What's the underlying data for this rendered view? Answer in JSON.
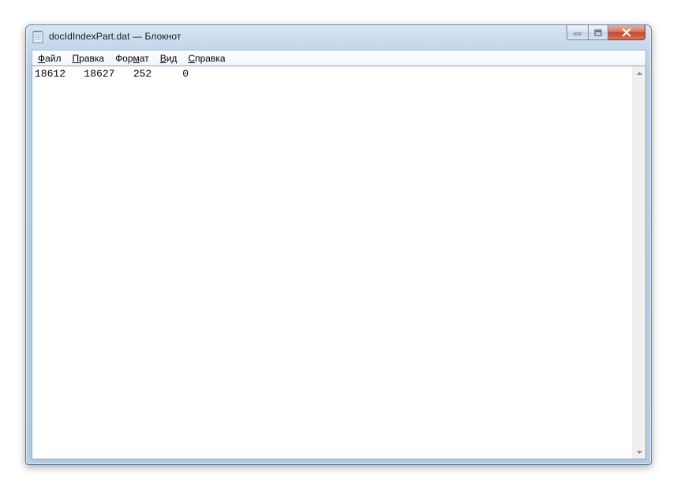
{
  "window": {
    "title": "docIdIndexPart.dat — Блокнот",
    "caption_buttons": {
      "minimize_icon": "minimize-icon",
      "maximize_icon": "maximize-icon",
      "close_icon": "close-icon"
    }
  },
  "menu": {
    "items": [
      {
        "pre": "",
        "key": "Ф",
        "post": "айл"
      },
      {
        "pre": "",
        "key": "П",
        "post": "равка"
      },
      {
        "pre": "Фор",
        "key": "м",
        "post": "ат"
      },
      {
        "pre": "",
        "key": "В",
        "post": "ид"
      },
      {
        "pre": "",
        "key": "С",
        "post": "правка"
      }
    ]
  },
  "editor": {
    "content": "18612\t18627\t252\t0"
  },
  "colors": {
    "frame": "#b9cfe6",
    "close_button": "#c2462c",
    "editor_bg": "#ffffff"
  }
}
